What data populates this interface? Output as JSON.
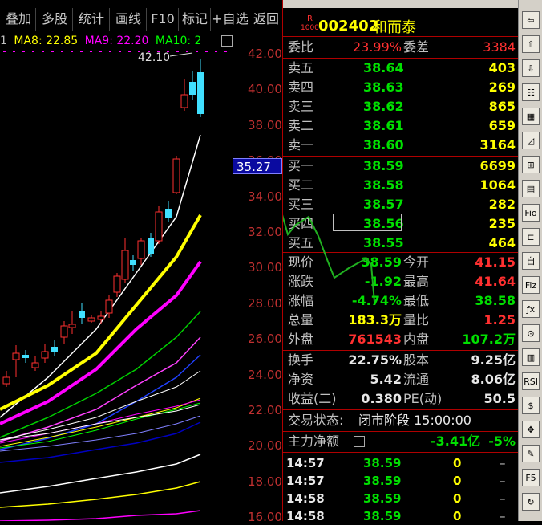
{
  "toolbar": {
    "buttons": [
      "叠加",
      "多股",
      "统计",
      "画线",
      "F10",
      "标记",
      "+自选",
      "返回"
    ]
  },
  "ma_legend": {
    "prefix": "1",
    "ma8": "MA8: 22.85",
    "ma9": "MA9: 22.20",
    "ma10": "MA10: 2",
    "colors": {
      "ma8": "#ffff00",
      "ma9": "#ff00ff",
      "ma10": "#00ff00"
    }
  },
  "chart": {
    "high_label": "42.10",
    "price_tag": "35.27",
    "axis_ticks": [
      "42.00",
      "40.00",
      "38.00",
      "36.00",
      "34.00",
      "32.00",
      "30.00",
      "28.00",
      "26.00",
      "24.00",
      "22.00",
      "20.00",
      "18.00",
      "16.00"
    ]
  },
  "stock": {
    "badge_top": "R",
    "badge_bottom": "1000",
    "code": "002402",
    "name": "和而泰"
  },
  "order_ratio": {
    "label": "委比",
    "value": "23.99%",
    "diff_label": "委差",
    "diff_value": "3384"
  },
  "asks": [
    {
      "label": "卖五",
      "price": "38.64",
      "vol": "403"
    },
    {
      "label": "卖四",
      "price": "38.63",
      "vol": "269"
    },
    {
      "label": "卖三",
      "price": "38.62",
      "vol": "865"
    },
    {
      "label": "卖二",
      "price": "38.61",
      "vol": "659"
    },
    {
      "label": "卖一",
      "price": "38.60",
      "vol": "3164"
    }
  ],
  "bids": [
    {
      "label": "买一",
      "price": "38.59",
      "vol": "6699"
    },
    {
      "label": "买二",
      "price": "38.58",
      "vol": "1064"
    },
    {
      "label": "买三",
      "price": "38.57",
      "vol": "282"
    },
    {
      "label": "买四",
      "price": "38.56",
      "vol": "235"
    },
    {
      "label": "买五",
      "price": "38.55",
      "vol": "464"
    }
  ],
  "quote": {
    "current_label": "现价",
    "current": "38.59",
    "open_label": "今开",
    "open": "41.15",
    "change_label": "涨跌",
    "change": "-1.92",
    "high_label": "最高",
    "high": "41.64",
    "pct_label": "涨幅",
    "pct": "-4.74%",
    "low_label": "最低",
    "low": "38.58",
    "volume_label": "总量",
    "volume": "183.3万",
    "vol_ratio_label": "量比",
    "vol_ratio": "1.25",
    "outer_label": "外盘",
    "outer": "761543",
    "inner_label": "内盘",
    "inner": "107.2万"
  },
  "fundamentals": {
    "turnover_label": "换手",
    "turnover": "22.75%",
    "equity_label": "股本",
    "equity": "9.25亿",
    "nav_label": "净资",
    "nav": "5.42",
    "float_label": "流通",
    "float": "8.06亿",
    "eps_label": "收益(二)",
    "eps": "0.380",
    "pe_label": "PE(动)",
    "pe": "50.5"
  },
  "status": {
    "label": "交易状态:",
    "value": "闭市阶段 15:00:00"
  },
  "net_flow": {
    "label": "主力净额",
    "value": "-3.41亿",
    "pct": "-5%"
  },
  "trades": [
    {
      "time": "14:57",
      "price": "38.59",
      "qty": "0",
      "dir": "–"
    },
    {
      "time": "14:57",
      "price": "38.59",
      "qty": "0",
      "dir": "–"
    },
    {
      "time": "14:58",
      "price": "38.59",
      "qty": "0",
      "dir": "–"
    },
    {
      "time": "14:58",
      "price": "38.59",
      "qty": "0",
      "dir": "–"
    }
  ],
  "sidebar_icons": [
    "arrow-left-icon",
    "arrow-up-icon",
    "arrow-down-icon",
    "list-icon",
    "table-icon",
    "line-chart-icon",
    "candlestick-icon",
    "grid-icon",
    "fio-icon",
    "tree-icon",
    "self-icon",
    "fiz-icon",
    "fx-icon",
    "zoom-icon",
    "bar-icon",
    "rsi-icon",
    "dollar-icon",
    "crosshair-icon",
    "pen-icon",
    "f5-icon",
    "refresh-icon"
  ],
  "sidebar_labels": [
    "⇦",
    "⇧",
    "⇩",
    "☷",
    "▦",
    "◿",
    "⊞",
    "▤",
    "Fio",
    "⊏",
    "自",
    "Fiz",
    "ƒx",
    "⊙",
    "▥",
    "RSI",
    "$",
    "✥",
    "✎",
    "F5",
    "↻"
  ]
}
